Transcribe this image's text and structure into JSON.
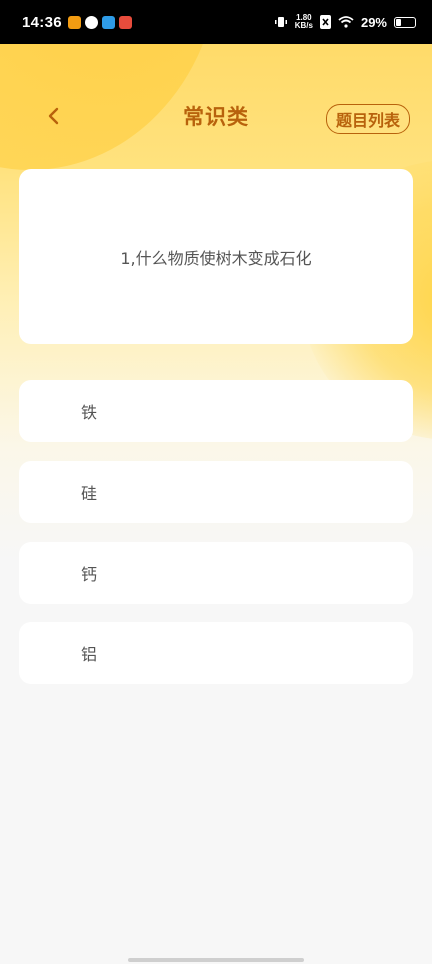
{
  "status_bar": {
    "time": "14:36",
    "speed_value": "1.80",
    "speed_unit": "KB/s",
    "battery": "29%",
    "battery_level": 0.29,
    "apps": [
      "weibo-app-icon",
      "browser-app-icon",
      "photos-app-icon",
      "news-app-icon"
    ]
  },
  "header": {
    "title": "常识类",
    "back_icon": "chevron-left-icon",
    "list_button": "题目列表"
  },
  "question": {
    "text": "1,什么物质使树木变成石化"
  },
  "options": [
    {
      "label": "铁"
    },
    {
      "label": "硅"
    },
    {
      "label": "钙"
    },
    {
      "label": "铝"
    }
  ],
  "colors": {
    "accent": "#b8620c",
    "background_top": "#ffd862",
    "background": "#f7f7f7"
  }
}
